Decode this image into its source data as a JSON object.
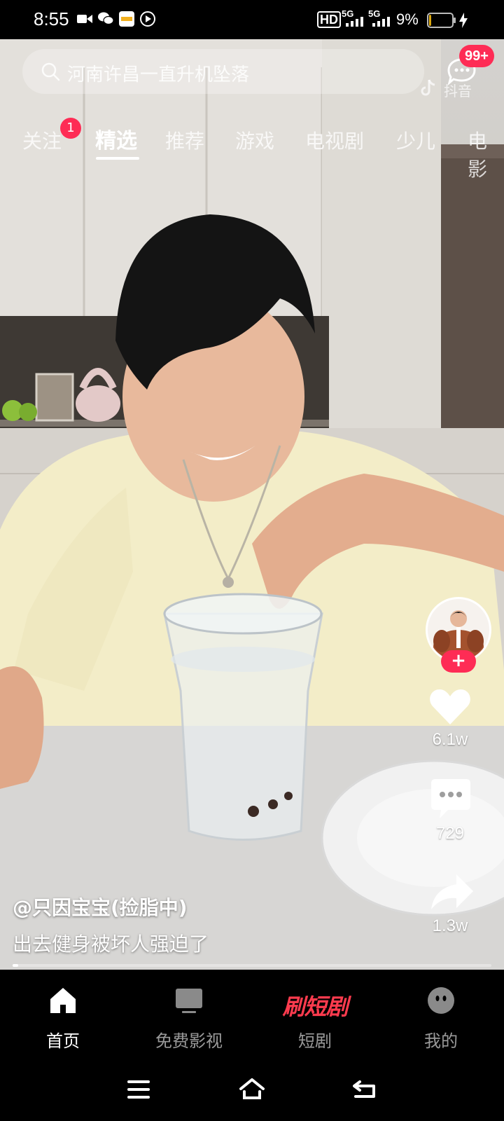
{
  "status_bar": {
    "time": "8:55",
    "hd_label": "HD",
    "signal1_label": "5G",
    "signal2_label": "5G",
    "battery_percent": "9%",
    "battery_level": 0.09
  },
  "header": {
    "search_text": "河南许昌一直升机坠落",
    "message_badge": "99+",
    "brand_text": "抖音"
  },
  "tabs": [
    {
      "label": "关注",
      "badge": "1"
    },
    {
      "label": "精选",
      "active": true
    },
    {
      "label": "推荐"
    },
    {
      "label": "游戏"
    },
    {
      "label": "电视剧"
    },
    {
      "label": "少儿"
    },
    {
      "label": "电影"
    }
  ],
  "actions": {
    "follow_label": "+",
    "likes": "6.1w",
    "comments": "729",
    "shares": "1.3w"
  },
  "video": {
    "author": "@只因宝宝(捡脂中)",
    "caption": "出去健身被坏人强迫了",
    "progress": 0.01
  },
  "bottom_nav": [
    {
      "label": "首页",
      "icon": "home-icon",
      "active": true
    },
    {
      "label": "免费影视",
      "icon": "tv-icon"
    },
    {
      "label": "短剧",
      "brand": "刷短剧"
    },
    {
      "label": "我的",
      "icon": "profile-icon"
    }
  ],
  "colors": {
    "accent": "#fe2c55",
    "brand_red": "#ff3b4e",
    "background": "#000000"
  }
}
